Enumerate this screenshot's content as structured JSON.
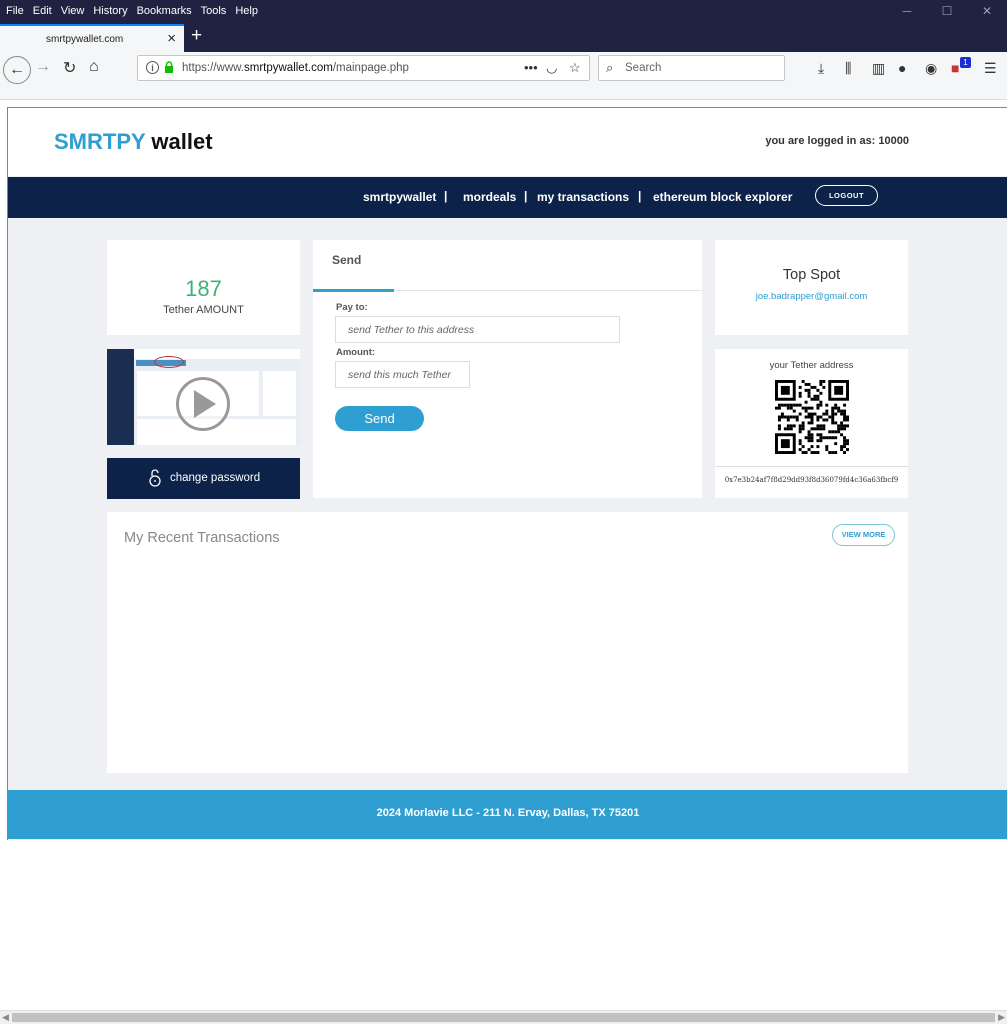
{
  "menubar": {
    "items": [
      "File",
      "Edit",
      "View",
      "History",
      "Bookmarks",
      "Tools",
      "Help"
    ]
  },
  "browser": {
    "tab_title": "smrtpywallet.com",
    "url_prefix": "https://www.",
    "url_domain": "smrtpywallet.com",
    "url_path": "/mainpage.php",
    "search_placeholder": "Search",
    "addon_badge": "1"
  },
  "header": {
    "logo_part1": "SMRTPY",
    "logo_part2": "wallet",
    "logged_in": "you are logged in as: 10000"
  },
  "nav": {
    "items": [
      "smrtpywallet",
      "mordeals",
      "my transactions",
      "ethereum block explorer"
    ],
    "separator": "|",
    "logout": "LOGOUT"
  },
  "balance": {
    "amount": "187",
    "label": "Tether AMOUNT"
  },
  "change_password": "change password",
  "send": {
    "title": "Send",
    "pay_to_label": "Pay to:",
    "pay_to_placeholder": "send Tether to this address",
    "amount_label": "Amount:",
    "amount_placeholder": "send this much Tether",
    "button": "Send"
  },
  "top_spot": {
    "title": "Top Spot",
    "email": "joe.badrapper@gmail.com"
  },
  "address": {
    "title": "your Tether address",
    "value": "0x7e3b24af7f8d29dd93f8d36079fd4c36a63fbcf9"
  },
  "transactions": {
    "title": "My Recent Transactions",
    "view_more": "VIEW MORE"
  },
  "footer": {
    "text": "2024 Morlavie LLC - 211 N. Ervay, Dallas, TX 75201"
  },
  "colors": {
    "accent": "#2f9ed0",
    "navy": "#0d2249",
    "green": "#3cb371",
    "chrome": "#1f2241"
  }
}
